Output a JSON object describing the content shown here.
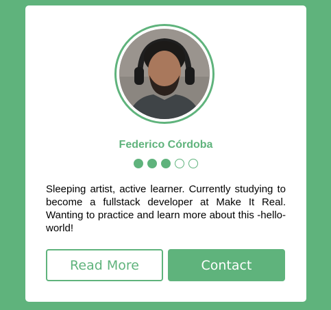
{
  "profile": {
    "name": "Federico Córdoba",
    "bio": "Sleeping artist, active learner. Currently studying to become a fullstack developer at Make It Real. Wanting to practice and learn more about this -hello- world!",
    "rating": {
      "value": 3,
      "max": 5
    },
    "avatar_icon": "profile-photo"
  },
  "actions": {
    "read_more_label": "Read More",
    "contact_label": "Contact"
  },
  "colors": {
    "background": "#5fb37c",
    "accent": "#5fb37c",
    "card": "#ffffff"
  }
}
